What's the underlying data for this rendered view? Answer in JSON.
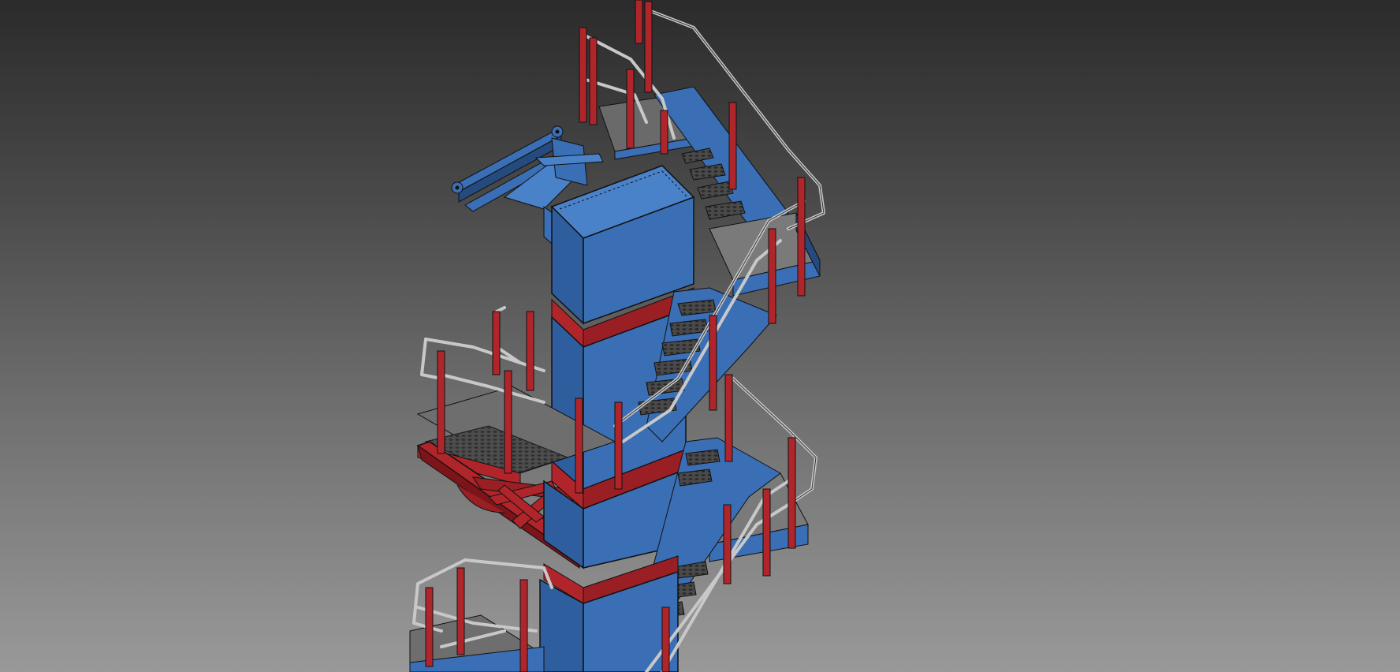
{
  "viewport": {
    "background_top": "#2b2b2b",
    "background_bottom": "#999999"
  },
  "model": {
    "description_visible_text": "",
    "colors": {
      "structure_blue": "#3a6fb5",
      "structure_blue_dark": "#244a7e",
      "structure_blue_light": "#4a82c9",
      "accent_red": "#b0252a",
      "accent_red_dark": "#7d1419",
      "rail_silver": "#c8c8c8",
      "tread_grey": "#5a5a5a",
      "floor_grey": "#7a7a7a",
      "edge_black": "#111111"
    }
  }
}
